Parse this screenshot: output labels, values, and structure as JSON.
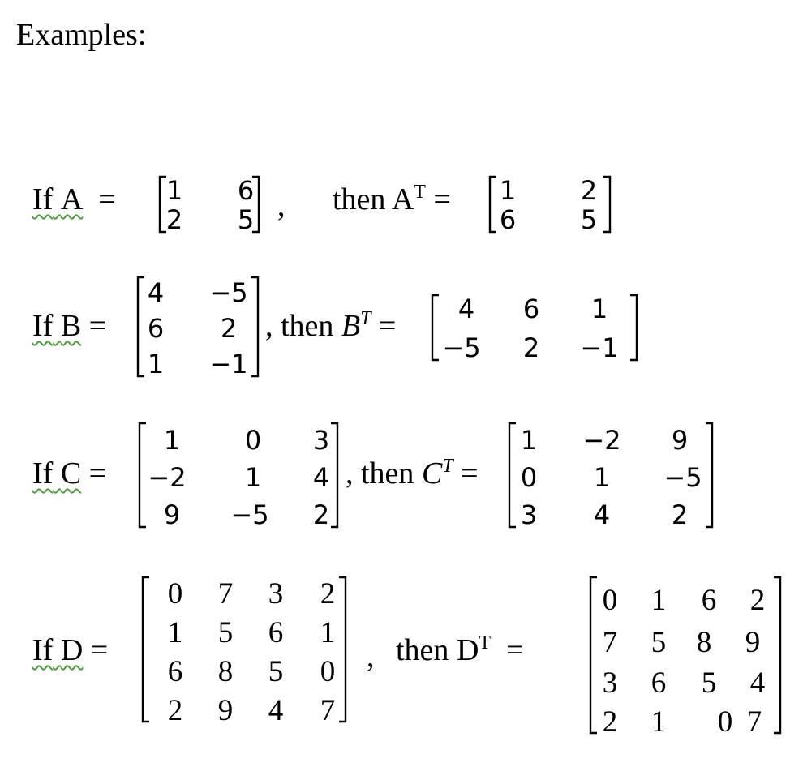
{
  "heading": "Examples:",
  "examples": [
    {
      "if": "If",
      "name": "A",
      "eq": "=",
      "comma": ",",
      "then": "then",
      "tname": "A",
      "sup": "T",
      "teq": "=",
      "matrix": [
        [
          "1",
          "6"
        ],
        [
          "2",
          "5"
        ]
      ],
      "transpose": [
        [
          "1",
          "2"
        ],
        [
          "6",
          "5"
        ]
      ]
    },
    {
      "if": "If",
      "name": "B",
      "eq": "=",
      "comma": ",",
      "then": "then",
      "tname": "B",
      "sup": "T",
      "teq": "=",
      "matrix": [
        [
          "4",
          "−5"
        ],
        [
          "6",
          "2"
        ],
        [
          "1",
          "−1"
        ]
      ],
      "transpose": [
        [
          "4",
          "6",
          "1"
        ],
        [
          "−5",
          "2",
          "−1"
        ]
      ]
    },
    {
      "if": "If",
      "name": "C",
      "eq": "=",
      "comma": ",",
      "then": "then",
      "tname": "C",
      "sup": "T",
      "teq": "=",
      "matrix": [
        [
          "1",
          "0",
          "3"
        ],
        [
          "−2",
          "1",
          "4"
        ],
        [
          "9",
          "−5",
          "2"
        ]
      ],
      "transpose": [
        [
          "1",
          "−2",
          "9"
        ],
        [
          "0",
          "1",
          "−5"
        ],
        [
          "3",
          "4",
          "2"
        ]
      ]
    },
    {
      "if": "If",
      "name": "D",
      "eq": "=",
      "comma": ",",
      "then": "then",
      "tname": "D",
      "sup": "T",
      "teq": "=",
      "matrix": [
        [
          "0",
          "7",
          "3",
          "2"
        ],
        [
          "1",
          "5",
          "6",
          "1"
        ],
        [
          "6",
          "8",
          "5",
          "0"
        ],
        [
          "2",
          "9",
          "4",
          "7"
        ]
      ],
      "transpose": [
        [
          "0",
          "1",
          "6",
          "2"
        ],
        [
          "7",
          "5",
          "8",
          "9"
        ],
        [
          "3",
          "6",
          "5",
          "4"
        ],
        [
          "2",
          "1",
          "0",
          "7"
        ]
      ]
    }
  ]
}
